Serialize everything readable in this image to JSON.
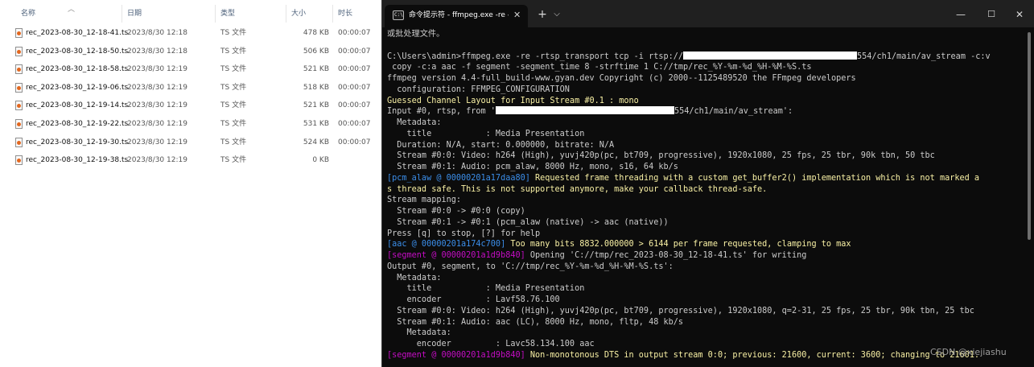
{
  "explorer": {
    "columns": {
      "name": "名称",
      "date": "日期",
      "type": "类型",
      "size": "大小",
      "duration": "时长"
    },
    "files": [
      {
        "name": "rec_2023-08-30_12-18-41.ts",
        "date": "2023/8/30 12:18",
        "type": "TS 文件",
        "size": "478 KB",
        "duration": "00:00:07"
      },
      {
        "name": "rec_2023-08-30_12-18-50.ts",
        "date": "2023/8/30 12:18",
        "type": "TS 文件",
        "size": "506 KB",
        "duration": "00:00:07"
      },
      {
        "name": "rec_2023-08-30_12-18-58.ts",
        "date": "2023/8/30 12:19",
        "type": "TS 文件",
        "size": "521 KB",
        "duration": "00:00:07"
      },
      {
        "name": "rec_2023-08-30_12-19-06.ts",
        "date": "2023/8/30 12:19",
        "type": "TS 文件",
        "size": "518 KB",
        "duration": "00:00:07"
      },
      {
        "name": "rec_2023-08-30_12-19-14.ts",
        "date": "2023/8/30 12:19",
        "type": "TS 文件",
        "size": "521 KB",
        "duration": "00:00:07"
      },
      {
        "name": "rec_2023-08-30_12-19-22.ts",
        "date": "2023/8/30 12:19",
        "type": "TS 文件",
        "size": "531 KB",
        "duration": "00:00:07"
      },
      {
        "name": "rec_2023-08-30_12-19-30.ts",
        "date": "2023/8/30 12:19",
        "type": "TS 文件",
        "size": "524 KB",
        "duration": "00:00:07"
      },
      {
        "name": "rec_2023-08-30_12-19-38.ts",
        "date": "2023/8/30 12:19",
        "type": "TS 文件",
        "size": "0 KB",
        "duration": ""
      }
    ]
  },
  "terminal": {
    "tab_title": "命令提示符 - ffmpeg.exe  -re -",
    "tab_icon_text": "C:\\",
    "icons": {
      "close": "close-icon",
      "new_tab": "plus-icon",
      "dropdown": "chevron-down-icon",
      "minimize": "minimize-icon",
      "maximize": "maximize-icon"
    },
    "colors": {
      "background": "#0c0c0c",
      "text": "#cccccc",
      "warning_yellow": "#f9f1a5",
      "tag_blue": "#3b8eea",
      "tag_magenta": "#c40dc4"
    },
    "lines": [
      [
        {
          "t": "或批处理文件。"
        }
      ],
      [
        {
          "t": ""
        }
      ],
      [
        {
          "t": "C:\\Users\\admin>ffmpeg.exe -re -rtsp_transport tcp -i rtsp://"
        },
        {
          "r": 216
        },
        {
          "t": "554/ch1/main/av_stream -c:v"
        }
      ],
      [
        {
          "t": " copy -c:a aac -f segment -segment_time 8 -strftime 1 C://tmp/rec_%Y-%m-%d_%H-%M-%S.ts"
        }
      ],
      [
        {
          "t": "ffmpeg version 4.4-full_build-www.gyan.dev Copyright (c) 2000--1125489520 the FFmpeg developers"
        }
      ],
      [
        {
          "t": "  configuration: FFMPEG_CONFIGURATION"
        }
      ],
      [
        {
          "t": "Guessed Channel Layout for Input Stream #0.1 : mono",
          "c": "y"
        }
      ],
      [
        {
          "t": "Input #0, rtsp, from '"
        },
        {
          "r": 222
        },
        {
          "t": "554/ch1/main/av_stream':"
        }
      ],
      [
        {
          "t": "  Metadata:"
        }
      ],
      [
        {
          "t": "    title           : Media Presentation"
        }
      ],
      [
        {
          "t": "  Duration: N/A, start: 0.000000, bitrate: N/A"
        }
      ],
      [
        {
          "t": "  Stream #0:0: Video: h264 (High), yuvj420p(pc, bt709, progressive), 1920x1080, 25 fps, 25 tbr, 90k tbn, 50 tbc"
        }
      ],
      [
        {
          "t": "  Stream #0:1: Audio: pcm_alaw, 8000 Hz, mono, s16, 64 kb/s"
        }
      ],
      [
        {
          "t": "[pcm_alaw @ 00000201a17daa80] ",
          "c": "b"
        },
        {
          "t": "Requested frame threading with a custom get_buffer2() implementation which is not marked a",
          "c": "y"
        }
      ],
      [
        {
          "t": "s thread safe. This is not supported anymore, make your callback thread-safe.",
          "c": "y"
        }
      ],
      [
        {
          "t": "Stream mapping:"
        }
      ],
      [
        {
          "t": "  Stream #0:0 -> #0:0 (copy)"
        }
      ],
      [
        {
          "t": "  Stream #0:1 -> #0:1 (pcm_alaw (native) -> aac (native))"
        }
      ],
      [
        {
          "t": "Press [q] to stop, [?] for help"
        }
      ],
      [
        {
          "t": "[aac @ 00000201a174c700] ",
          "c": "b"
        },
        {
          "t": "Too many bits 8832.000000 > 6144 per frame requested, clamping to max",
          "c": "y"
        }
      ],
      [
        {
          "t": "[segment @ 00000201a1d9b840] ",
          "c": "m"
        },
        {
          "t": "Opening 'C://tmp/rec_2023-08-30_12-18-41.ts' for writing"
        }
      ],
      [
        {
          "t": "Output #0, segment, to 'C://tmp/rec_%Y-%m-%d_%H-%M-%S.ts':"
        }
      ],
      [
        {
          "t": "  Metadata:"
        }
      ],
      [
        {
          "t": "    title           : Media Presentation"
        }
      ],
      [
        {
          "t": "    encoder         : Lavf58.76.100"
        }
      ],
      [
        {
          "t": "  Stream #0:0: Video: h264 (High), yuvj420p(pc, bt709, progressive), 1920x1080, q=2-31, 25 fps, 25 tbr, 90k tbn, 25 tbc"
        }
      ],
      [
        {
          "t": "  Stream #0:1: Audio: aac (LC), 8000 Hz, mono, fltp, 48 kb/s"
        }
      ],
      [
        {
          "t": "    Metadata:"
        }
      ],
      [
        {
          "t": "      encoder         : Lavc58.134.100 aac"
        }
      ],
      [
        {
          "t": "[segment @ 00000201a1d9b840] ",
          "c": "m"
        },
        {
          "t": "Non-monotonous DTS in output stream 0:0; previous: 21600, current: 3600; changing to 21601.",
          "c": "y"
        }
      ]
    ]
  },
  "watermark": "CSDN @xiejiashu"
}
